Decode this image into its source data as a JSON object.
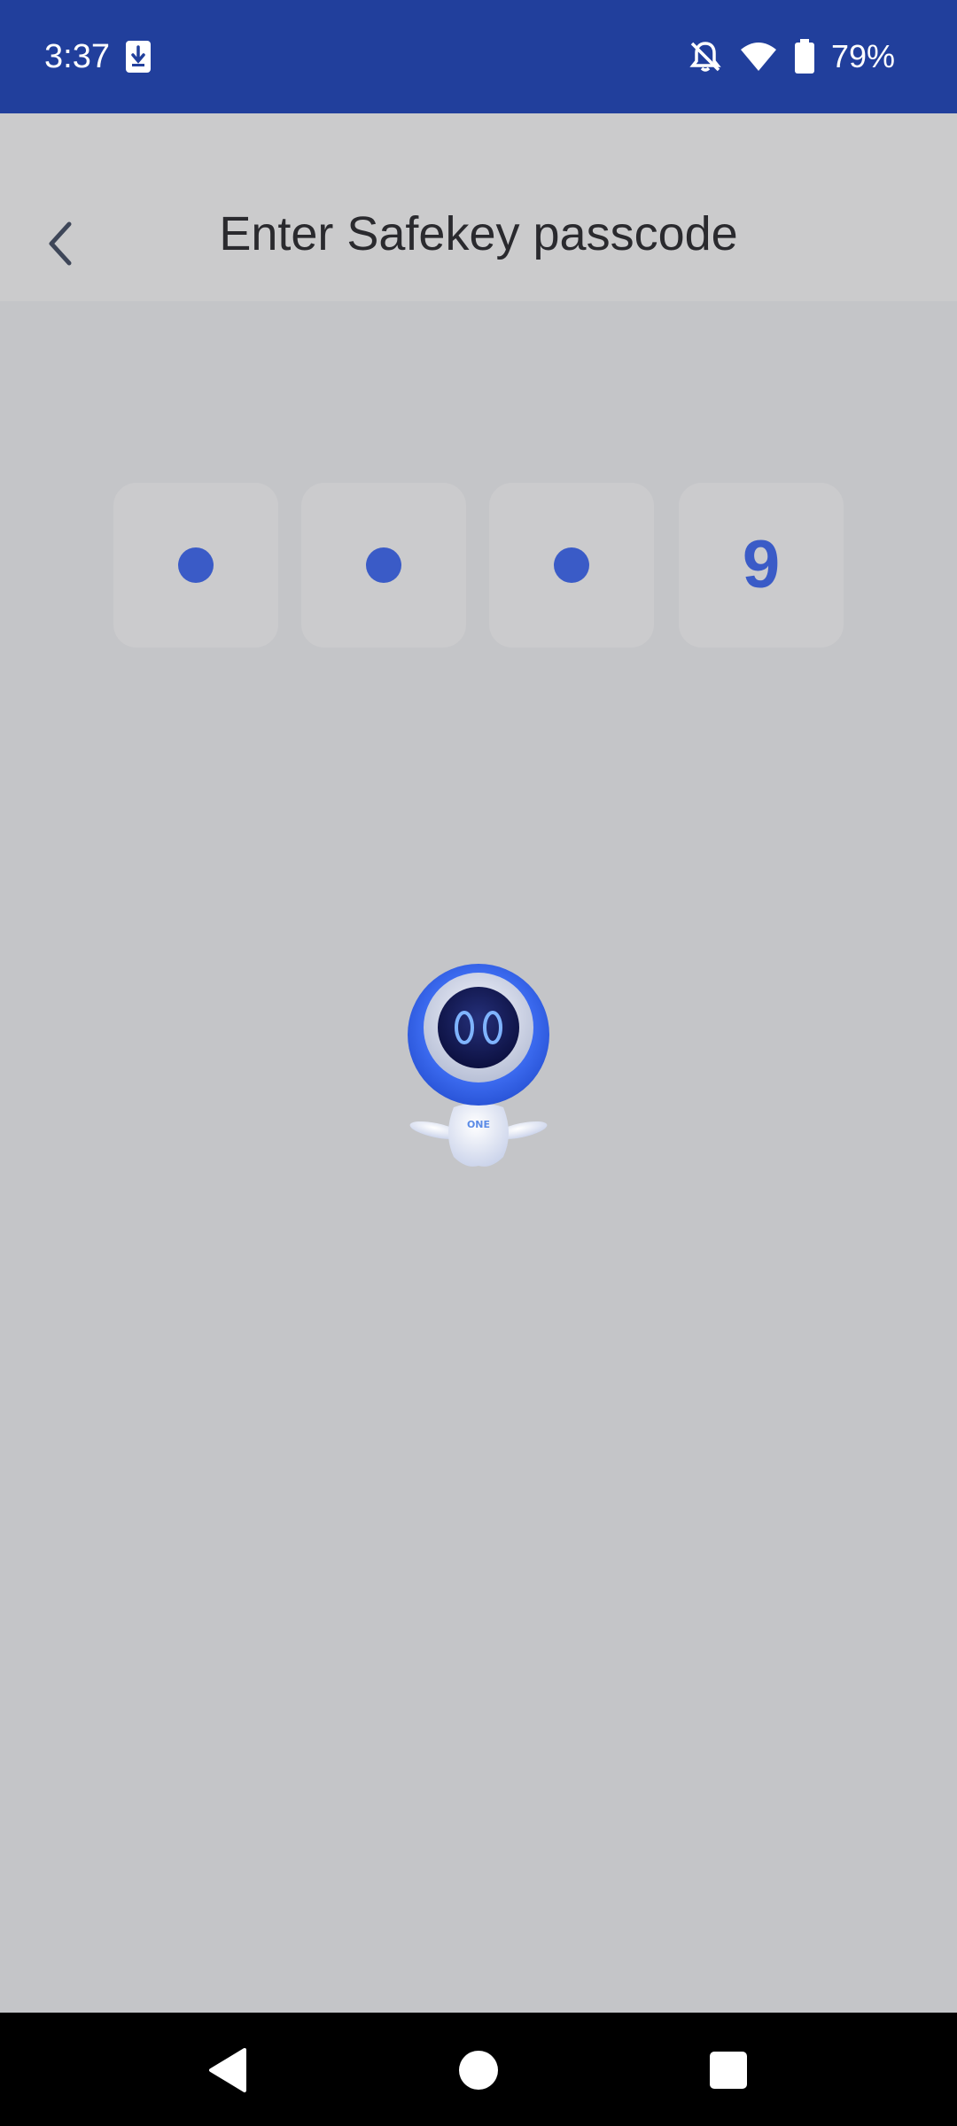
{
  "status_bar": {
    "time": "3:37",
    "battery_percent": "79%",
    "icons": [
      "download-icon",
      "notifications-off-icon",
      "wifi-icon",
      "battery-icon"
    ],
    "background": "#213f9c"
  },
  "header": {
    "title": "Enter Safekey passcode",
    "back_icon": "chevron-left-icon"
  },
  "passcode": {
    "length": 4,
    "entered": 4,
    "masked_count": 3,
    "last_digit": "9",
    "accent": "#3a5bc7"
  },
  "mascot": {
    "icon": "robot-mascot",
    "badge_text": "ONE"
  },
  "nav_bar": {
    "buttons": [
      "back-icon",
      "home-icon",
      "recents-icon"
    ]
  }
}
